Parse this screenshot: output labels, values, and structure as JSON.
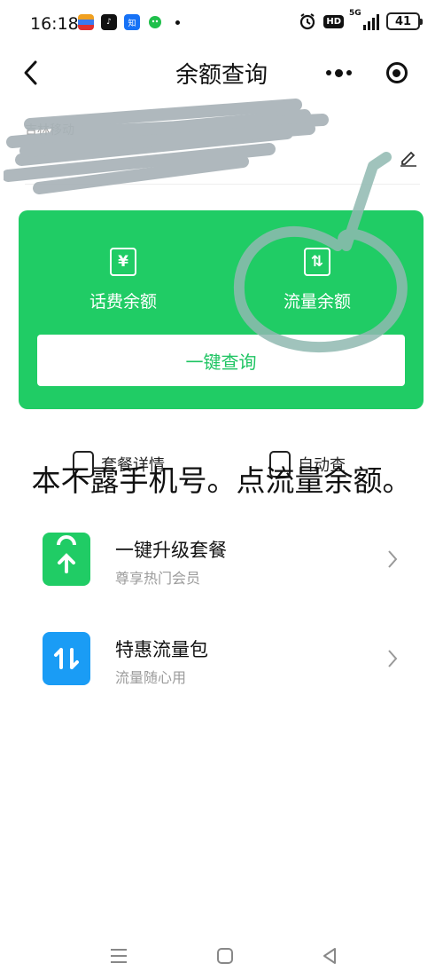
{
  "status_bar": {
    "time": "16:18",
    "network": "5G",
    "hd": "HD",
    "battery": "41",
    "app_icons": [
      "doc-app-icon",
      "tiktok-icon",
      "zhihu-icon",
      "wechat-icon"
    ]
  },
  "nav": {
    "title": "余额查询"
  },
  "account": {
    "carrier": "吉林移动"
  },
  "card": {
    "left_icon_glyph": "¥",
    "left_label": "话费余额",
    "right_icon_glyph": "⇅",
    "right_label": "流量余额",
    "query_button": "一键查询",
    "color": "#20cc65"
  },
  "quick_links": {
    "left": "套餐详情",
    "right": "自动查"
  },
  "caption": "本不露手机号。点流量余额。",
  "list": [
    {
      "title": "一键升级套餐",
      "subtitle": "尊享热门会员",
      "icon": "shopping-bag-up-icon",
      "color": "#20cc65"
    },
    {
      "title": "特惠流量包",
      "subtitle": "流量随心用",
      "icon": "data-arrows-icon",
      "color": "#1a9cf5"
    }
  ]
}
